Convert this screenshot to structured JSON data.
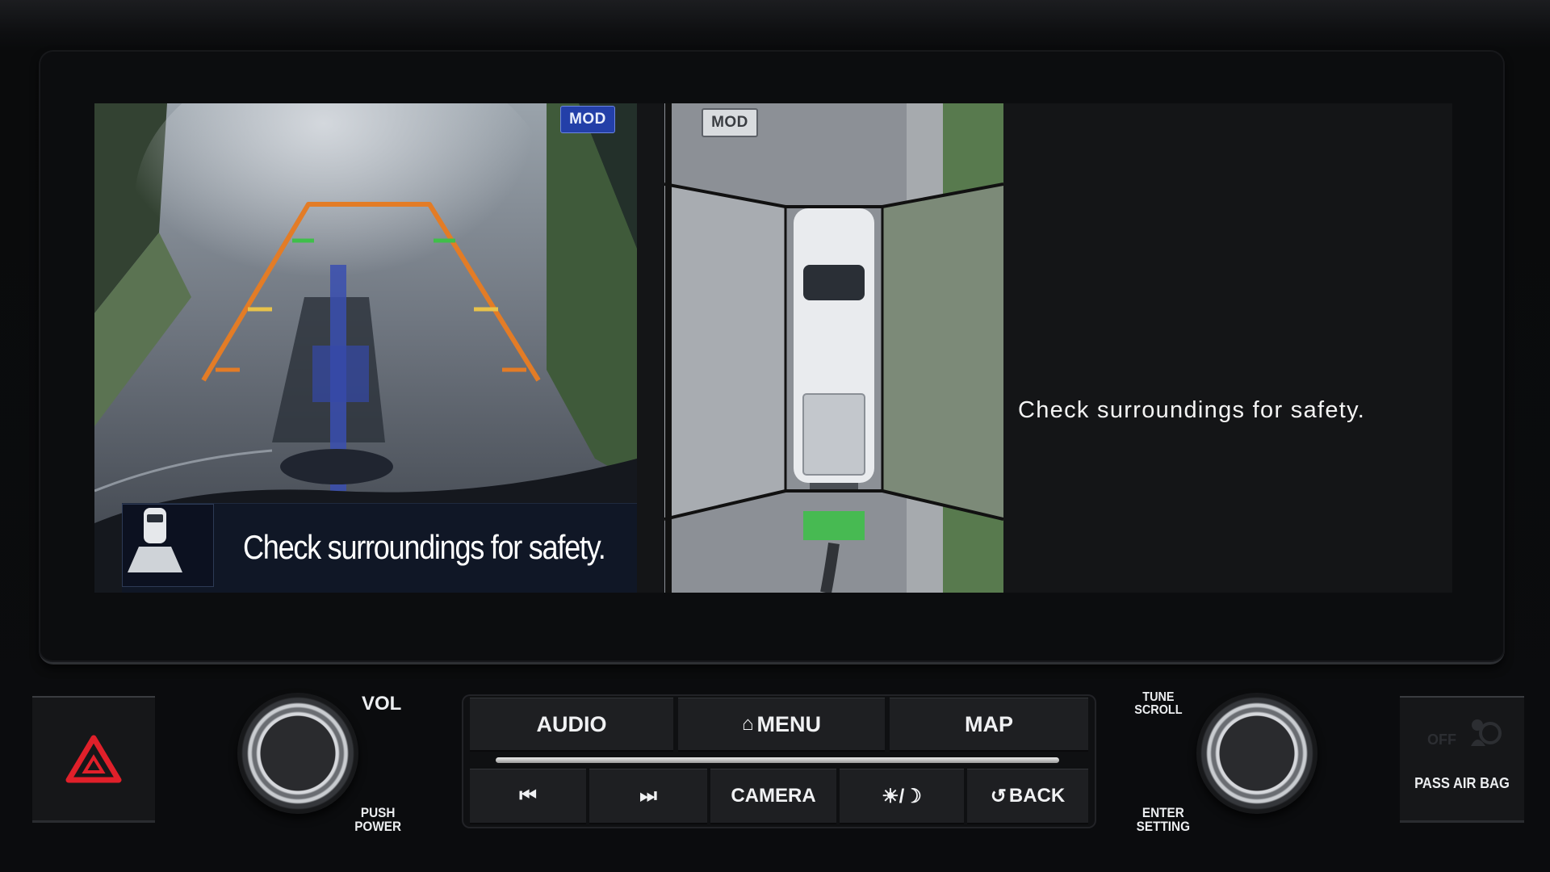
{
  "screen": {
    "rear_view": {
      "mod_badge": "MOD",
      "message": "Check surroundings for safety."
    },
    "birds_eye": {
      "mod_badge": "MOD"
    },
    "right_message": "Check surroundings for safety."
  },
  "controls": {
    "vol_label": "VOL",
    "push_power_label": "PUSH\nPOWER",
    "tune_scroll_label": "TUNE\nSCROLL",
    "enter_setting_label": "ENTER\nSETTING",
    "buttons_top": [
      {
        "label": "AUDIO"
      },
      {
        "label": "MENU",
        "icon": "home-icon"
      },
      {
        "label": "MAP"
      }
    ],
    "buttons_bottom": [
      {
        "label": "⏮",
        "icon": "previous-track-icon"
      },
      {
        "label": "⏭",
        "icon": "next-track-icon"
      },
      {
        "label": "CAMERA"
      },
      {
        "label": "☀/☽",
        "icon": "day-night-icon"
      },
      {
        "label": "BACK",
        "icon": "back-arrow-icon"
      }
    ],
    "airbag_label": "PASS AIR BAG",
    "hazard_icon": "hazard-triangle-icon"
  },
  "colors": {
    "guide_line": "#e37c26",
    "mod_blue": "#233fa8",
    "hazard_red": "#e0202a",
    "parking_green": "#3fbf4a"
  }
}
